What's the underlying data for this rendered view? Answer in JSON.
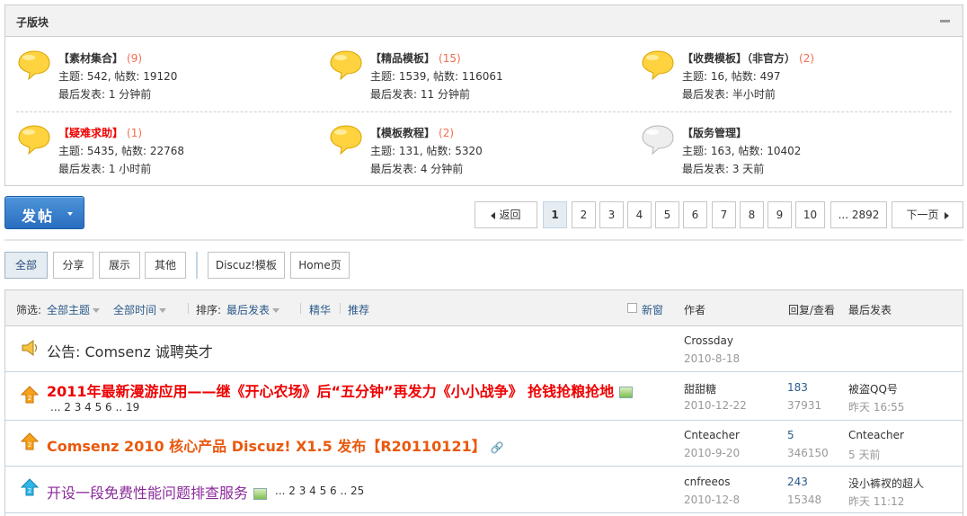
{
  "subforum": {
    "title": "子版块",
    "forums": [
      {
        "name": "【素材集合】",
        "count": "(9)",
        "stats": "主题: 542, 帖数: 19120",
        "last": "最后发表: 1 分钟前",
        "red": false
      },
      {
        "name": "【精品模板】",
        "count": "(15)",
        "stats": "主题: 1539, 帖数: 116061",
        "last": "最后发表: 11 分钟前",
        "red": false
      },
      {
        "name": "【收费模板】（非官方）",
        "count": "(2)",
        "stats": "主题: 16, 帖数: 497",
        "last": "最后发表: 半小时前",
        "red": false
      },
      {
        "name": "【疑难求助】",
        "count": "(1)",
        "stats": "主题: 5435, 帖数: 22768",
        "last": "最后发表: 1 小时前",
        "red": true
      },
      {
        "name": "【模板教程】",
        "count": "(2)",
        "stats": "主题: 131, 帖数: 5320",
        "last": "最后发表: 4 分钟前",
        "red": false
      },
      {
        "name": "【版务管理】",
        "count": "",
        "stats": "主题: 163, 帖数: 10402",
        "last": "最后发表: 3 天前",
        "red": false
      }
    ]
  },
  "post_button": {
    "label": "发帖"
  },
  "pagination": {
    "back": "返回",
    "pages": [
      "1",
      "2",
      "3",
      "4",
      "5",
      "6",
      "7",
      "8",
      "9",
      "10",
      "... 2892"
    ],
    "current": "1",
    "next": "下一页"
  },
  "type_tabs": {
    "all": "全部",
    "share": "分享",
    "show": "展示",
    "other": "其他",
    "discuz_template": "Discuz!模板",
    "home": "Home页"
  },
  "filter_bar": {
    "filter_label": "筛选:",
    "all_topics": "全部主题",
    "all_time": "全部时间",
    "sort_label": "排序:",
    "sort_value": "最后发表",
    "digest": "精华",
    "recommend": "推荐",
    "new_window": "新窗",
    "col_author": "作者",
    "col_replies": "回复/查看",
    "col_last": "最后发表"
  },
  "threads": [
    {
      "title": "公告: Comsenz 诚聘英才",
      "author": "Crossday",
      "date": "2010-8-18",
      "replies": "",
      "views": "",
      "last_user": "",
      "last_time": "",
      "pages": ""
    },
    {
      "title": "2011年最新漫游应用——继《开心农场》后“五分钟”再发力《小小战争》 抢钱抢粮抢地",
      "author": "甜甜糖",
      "date": "2010-12-22",
      "replies": "183",
      "views": "37931",
      "last_user": "被盗QQ号",
      "last_time": "昨天 16:55",
      "pages": "... 2 3 4 5 6 .. 19"
    },
    {
      "title": "Comsenz 2010 核心产品 Discuz! X1.5 发布【R20110121】",
      "author": "Cnteacher",
      "date": "2010-9-20",
      "replies": "5",
      "views": "346150",
      "last_user": "Cnteacher",
      "last_time": "5 天前",
      "pages": ""
    },
    {
      "title": "开设一段免费性能问题排查服务",
      "author": "cnfreeos",
      "date": "2010-12-8",
      "replies": "243",
      "views": "15348",
      "last_user": "没小裤衩的超人",
      "last_time": "昨天 11:12",
      "pages": "... 2 3 4 5 6 .. 25"
    }
  ],
  "colors": {
    "accent": "#2b5a8a",
    "red_title": "#ee0000",
    "orange_title": "#e9590e",
    "purple_title": "#8a2b9a",
    "count": "#f26c4f"
  }
}
